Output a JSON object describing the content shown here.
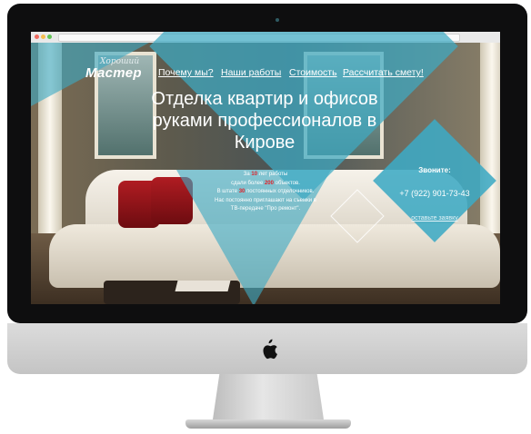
{
  "site": {
    "logo": {
      "script_text": "Хороший",
      "main_text": "Мастер"
    },
    "nav": [
      {
        "label": "Почему мы?"
      },
      {
        "label": "Наши работы"
      },
      {
        "label": "Стоимость"
      },
      {
        "label": "Рассчитать смету!"
      }
    ],
    "headline": "Отделка квартир и офисов руками профессионалов в Кирове",
    "copy": {
      "line1_a": "За ",
      "line1_num": "10",
      "line1_b": " лет работы",
      "line2_a": "сдали более ",
      "line2_num": "200",
      "line2_b": " объектов.",
      "line3_a": "В штате ",
      "line3_num": "30",
      "line3_b": " постоянных отделочников.",
      "line4": "Нас постоянно приглашают на съемки в",
      "line5": "ТВ-передаче \"Про ремонт\"."
    },
    "call": {
      "label": "Звоните:",
      "phone": "+7 (922) 901-73-43",
      "request_link": "оставьте заявку"
    }
  },
  "colors": {
    "accent": "#3eaac4",
    "highlight": "#e0232b",
    "bezel": "#0e0e0f",
    "chin": "#d0d0d0"
  },
  "icons": [
    "apple-logo-icon"
  ]
}
